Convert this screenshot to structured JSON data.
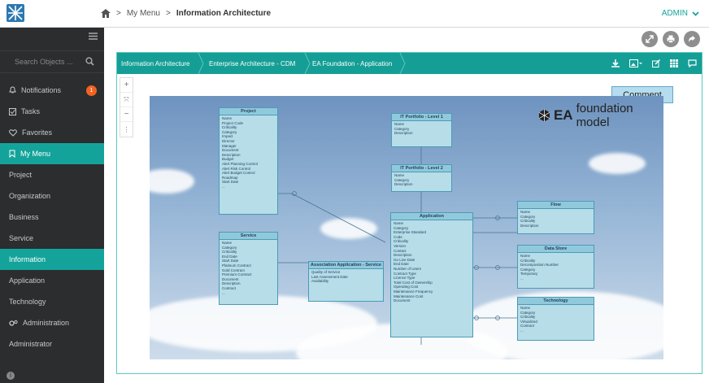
{
  "header": {
    "breadcrumb": [
      "My Menu",
      "Information Architecture"
    ],
    "user": "ADMIN"
  },
  "sidebar": {
    "search_placeholder": "Search Objects ...",
    "items": [
      {
        "label": "Notifications",
        "badge": "1"
      },
      {
        "label": "Tasks"
      },
      {
        "label": "Favorites"
      },
      {
        "label": "My Menu",
        "active": true
      },
      {
        "label": "Project"
      },
      {
        "label": "Organization"
      },
      {
        "label": "Business"
      },
      {
        "label": "Service"
      },
      {
        "label": "Information",
        "active": true
      },
      {
        "label": "Application"
      },
      {
        "label": "Technology"
      },
      {
        "label": "Administration"
      },
      {
        "label": "Administrator"
      }
    ]
  },
  "panel": {
    "breadcrumb": [
      "Information Architecture",
      "Enterprise Architecture - CDM",
      "EA Foundation - Application"
    ],
    "tooltip": "Comment"
  },
  "diagram": {
    "logo": {
      "brand": "EA",
      "text": "foundation model"
    },
    "entities": [
      {
        "title": "Project",
        "fields": [
          "Name",
          "Project Code",
          "Criticality",
          "Category",
          "Impact",
          "Director",
          "Manager",
          "Document",
          "Description",
          "Budget",
          "Alert Planning Control",
          "Alert Risk Control",
          "Alert Budget Control",
          "Roadmap",
          "Start Date",
          "..."
        ]
      },
      {
        "title": "IT Portfolio - Level 1",
        "fields": [
          "Name",
          "Category",
          "Description"
        ]
      },
      {
        "title": "IT Portfolio - Level 2",
        "fields": [
          "Name",
          "Category",
          "Description"
        ]
      },
      {
        "title": "Application",
        "fields": [
          "Name",
          "Category",
          "Enterprise Standard",
          "Code",
          "Criticality",
          "Version",
          "Contact",
          "Description",
          "Go Live Date",
          "End Date",
          "Number of Users",
          "Contract Type",
          "Licence Type",
          "Total Cost of Ownership",
          "Operating Cost",
          "Maintenance Frequency",
          "Maintenance Cost",
          "Document"
        ]
      },
      {
        "title": "Service",
        "fields": [
          "Name",
          "Category",
          "Criticality",
          "End Date",
          "Start Date",
          "Platinum Contract",
          "Gold Contract",
          "Premium Contract",
          "Document",
          "Description",
          "Contract",
          "..."
        ]
      },
      {
        "title": "Association Application - Service",
        "fields": [
          "Quality of Service",
          "Last Assessment Date",
          "Availability"
        ]
      },
      {
        "title": "Flow",
        "fields": [
          "Name",
          "Category",
          "Criticality",
          "Description"
        ]
      },
      {
        "title": "Data Store",
        "fields": [
          "Name",
          "Criticality",
          "Decomposition Number",
          "Category",
          "Temporary",
          "..."
        ]
      },
      {
        "title": "Technology",
        "fields": [
          "Name",
          "Category",
          "Criticality",
          "Virtualized",
          "Contract",
          "..."
        ]
      }
    ]
  },
  "colors": {
    "accent": "#14a39a",
    "sidebar": "#2b2d2f",
    "badge": "#f26322",
    "entity_fill": "#b6dde8"
  }
}
